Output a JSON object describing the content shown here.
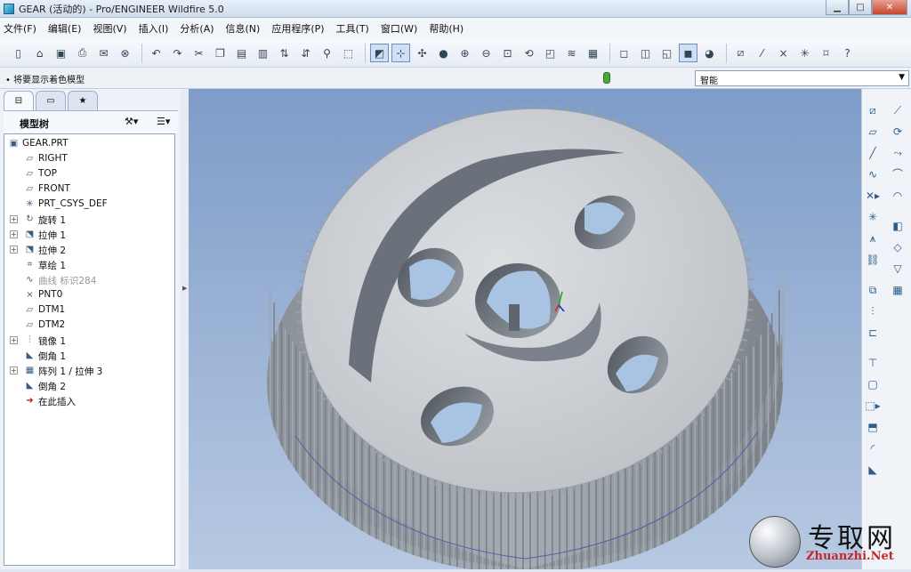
{
  "window": {
    "title": "GEAR (活动的) - Pro/ENGINEER Wildfire 5.0"
  },
  "menu": [
    "文件(F)",
    "编辑(E)",
    "视图(V)",
    "插入(I)",
    "分析(A)",
    "信息(N)",
    "应用程序(P)",
    "工具(T)",
    "窗口(W)",
    "帮助(H)"
  ],
  "status": {
    "message": "• 将要显示着色模型",
    "filter_value": "智能"
  },
  "model_tree": {
    "title": "模型树",
    "nodes": [
      {
        "label": "GEAR.PRT",
        "icon": "part-icon",
        "expand": false
      },
      {
        "label": "RIGHT",
        "icon": "datum-plane-icon",
        "expand": false
      },
      {
        "label": "TOP",
        "icon": "datum-plane-icon",
        "expand": false
      },
      {
        "label": "FRONT",
        "icon": "datum-plane-icon",
        "expand": false
      },
      {
        "label": "PRT_CSYS_DEF",
        "icon": "csys-icon",
        "expand": false
      },
      {
        "label": "旋转 1",
        "icon": "revolve-icon",
        "expand": true
      },
      {
        "label": "拉伸 1",
        "icon": "extrude-icon",
        "expand": true
      },
      {
        "label": "拉伸 2",
        "icon": "extrude-icon",
        "expand": true
      },
      {
        "label": "草绘 1",
        "icon": "sketch-icon",
        "expand": false
      },
      {
        "label": "曲线 标识284",
        "icon": "curve-icon",
        "expand": false,
        "dim": true
      },
      {
        "label": "PNT0",
        "icon": "datum-point-icon",
        "expand": false
      },
      {
        "label": "DTM1",
        "icon": "datum-plane-icon",
        "expand": false
      },
      {
        "label": "DTM2",
        "icon": "datum-plane-icon",
        "expand": false
      },
      {
        "label": "镜像 1",
        "icon": "mirror-icon",
        "expand": true
      },
      {
        "label": "倒角 1",
        "icon": "chamfer-icon",
        "expand": false
      },
      {
        "label": "阵列 1 / 拉伸 3",
        "icon": "pattern-icon",
        "expand": true
      },
      {
        "label": "倒角 2",
        "icon": "chamfer-icon",
        "expand": false
      },
      {
        "label": "在此插入",
        "icon": "insert-here-icon",
        "expand": false
      }
    ]
  },
  "watermark": {
    "cn": "专取网",
    "en": "Zhuanzhi.Net"
  },
  "colors": {
    "viewport_top": "#7e9cc8",
    "viewport_bottom": "#b7c9e2",
    "gear": "#c9ccd0"
  }
}
